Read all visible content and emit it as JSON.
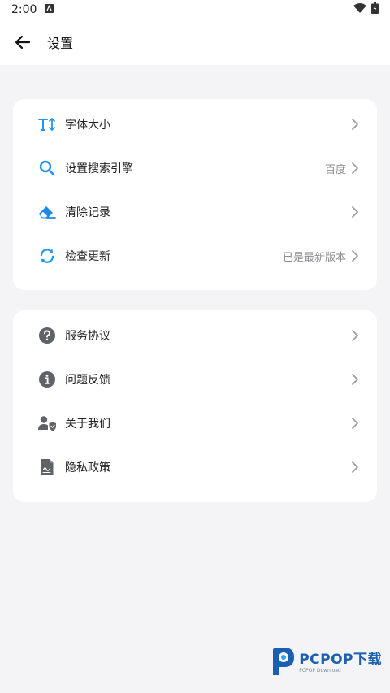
{
  "status_bar": {
    "time": "2:00"
  },
  "header": {
    "title": "设置"
  },
  "group1": {
    "items": [
      {
        "label": "字体大小",
        "value": "",
        "icon": "font-size-icon"
      },
      {
        "label": "设置搜索引擎",
        "value": "百度",
        "icon": "search-icon"
      },
      {
        "label": "清除记录",
        "value": "",
        "icon": "eraser-icon"
      },
      {
        "label": "检查更新",
        "value": "已是最新版本",
        "icon": "refresh-icon"
      }
    ]
  },
  "group2": {
    "items": [
      {
        "label": "服务协议",
        "value": "",
        "icon": "question-icon"
      },
      {
        "label": "问题反馈",
        "value": "",
        "icon": "info-icon"
      },
      {
        "label": "关于我们",
        "value": "",
        "icon": "user-shield-icon"
      },
      {
        "label": "隐私政策",
        "value": "",
        "icon": "document-icon"
      }
    ]
  },
  "watermark": {
    "text": "PCPOP下载",
    "subtext": "PCPOP Download"
  },
  "colors": {
    "accent": "#2196f3",
    "icon_gray": "#5f6368",
    "background": "#f4f4f6",
    "card": "#ffffff"
  }
}
